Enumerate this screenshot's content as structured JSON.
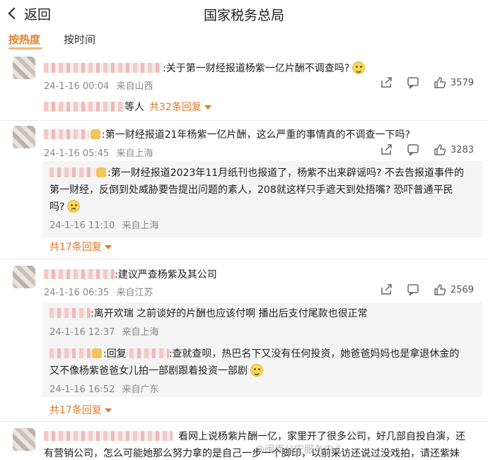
{
  "header": {
    "back_label": "返回",
    "title": "国家税务总局"
  },
  "tabs": {
    "hot": "按热度",
    "time": "按时间"
  },
  "comments": [
    {
      "text": ":关于第一财经报道杨紫一亿片酬不调查吗?",
      "time": "24-1-16 00:04",
      "location": "来自山西",
      "likes": "3579",
      "reply_hint": "等人",
      "reply_count": "共32条回复"
    },
    {
      "text": ":第一财经报道21年杨紫一亿片酬，这么严重的事情真的不调查一下吗?",
      "time": "24-1-16 05:45",
      "location": "来自上海",
      "likes": "3283",
      "reply": {
        "line1": ":第一财经报道2023年11月纸刊也报道了，杨紫不出来辟谣吗? 不去告报道事件的",
        "line2": "第一财经，反倒到处威胁要告提出问题的素人，208就这样只手遮天到处捂嘴? 恐吓普通平民",
        "line3": "吗?",
        "time": "24-1-16 11:10",
        "location": "来自上海"
      },
      "reply_count": "共17条回复"
    },
    {
      "text": ":建议严查杨紫及其公司",
      "time": "24-1-16 06:35",
      "location": "来自江苏",
      "likes": "2569",
      "reply_a": {
        "text": ":离开欢瑞 之前谈好的片酬也应该付啊 播出后支付尾款也很正常",
        "time": "24-1-16 12:37",
        "location": "来自上海"
      },
      "reply_b": {
        "prefix": ":回复",
        "line1": ":查就查呗，热巴名下又没有任何投资，她爸爸妈妈也是拿退休金的",
        "line2": "又不像杨紫爸爸女儿拍一部剧跟着投资一部剧",
        "time": "24-1-16 16:52",
        "location": "来自广东"
      },
      "reply_count": "共17条回复"
    },
    {
      "line1": "看网上说杨紫片酬一亿，家里开了很多公司，好几部自投自演，还",
      "line2": "有营销公司，怎么可能她那么努力拿的是自己一步一个脚印，以前采访还说过没戏拍，请还紫妹"
    }
  ],
  "watermark": "@闽南公安服务中心"
}
